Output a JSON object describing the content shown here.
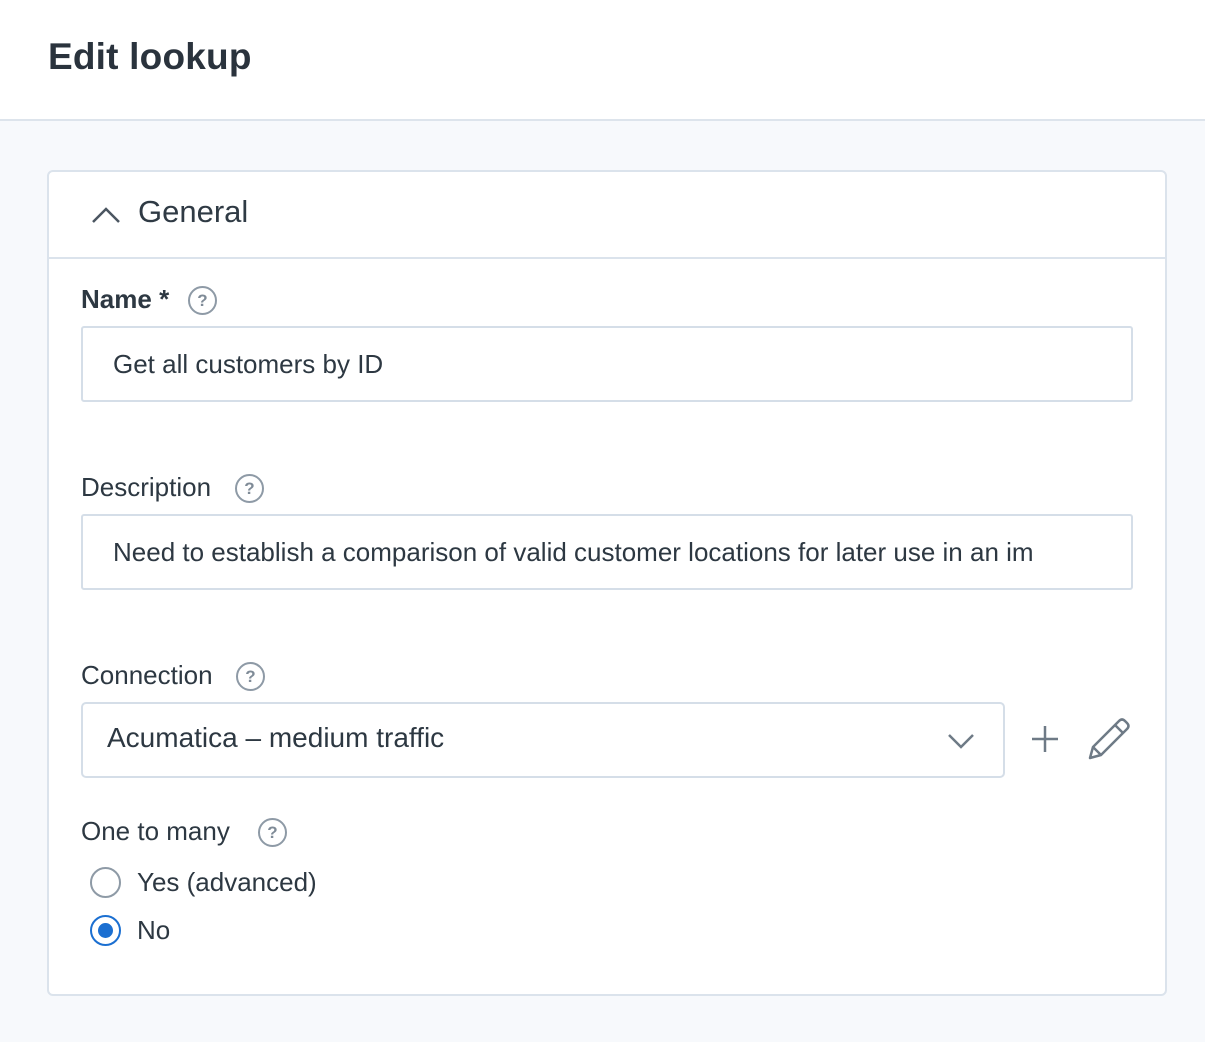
{
  "header": {
    "title": "Edit lookup"
  },
  "section": {
    "title": "General",
    "expanded": true
  },
  "fields": {
    "name": {
      "label": "Name",
      "required_marker": "*",
      "value": "Get all customers by ID"
    },
    "description": {
      "label": "Description",
      "value": "Need to establish a comparison of valid customer locations for later use in an im"
    },
    "connection": {
      "label": "Connection",
      "value": "Acumatica – medium traffic"
    },
    "one_to_many": {
      "label": "One to many",
      "options": [
        {
          "label": "Yes (advanced)",
          "checked": false
        },
        {
          "label": "No",
          "checked": true
        }
      ]
    }
  },
  "help_glyph": "?",
  "colors": {
    "accent": "#1b6fd1",
    "border": "#d5dee8",
    "icon": "#6e7a86"
  }
}
